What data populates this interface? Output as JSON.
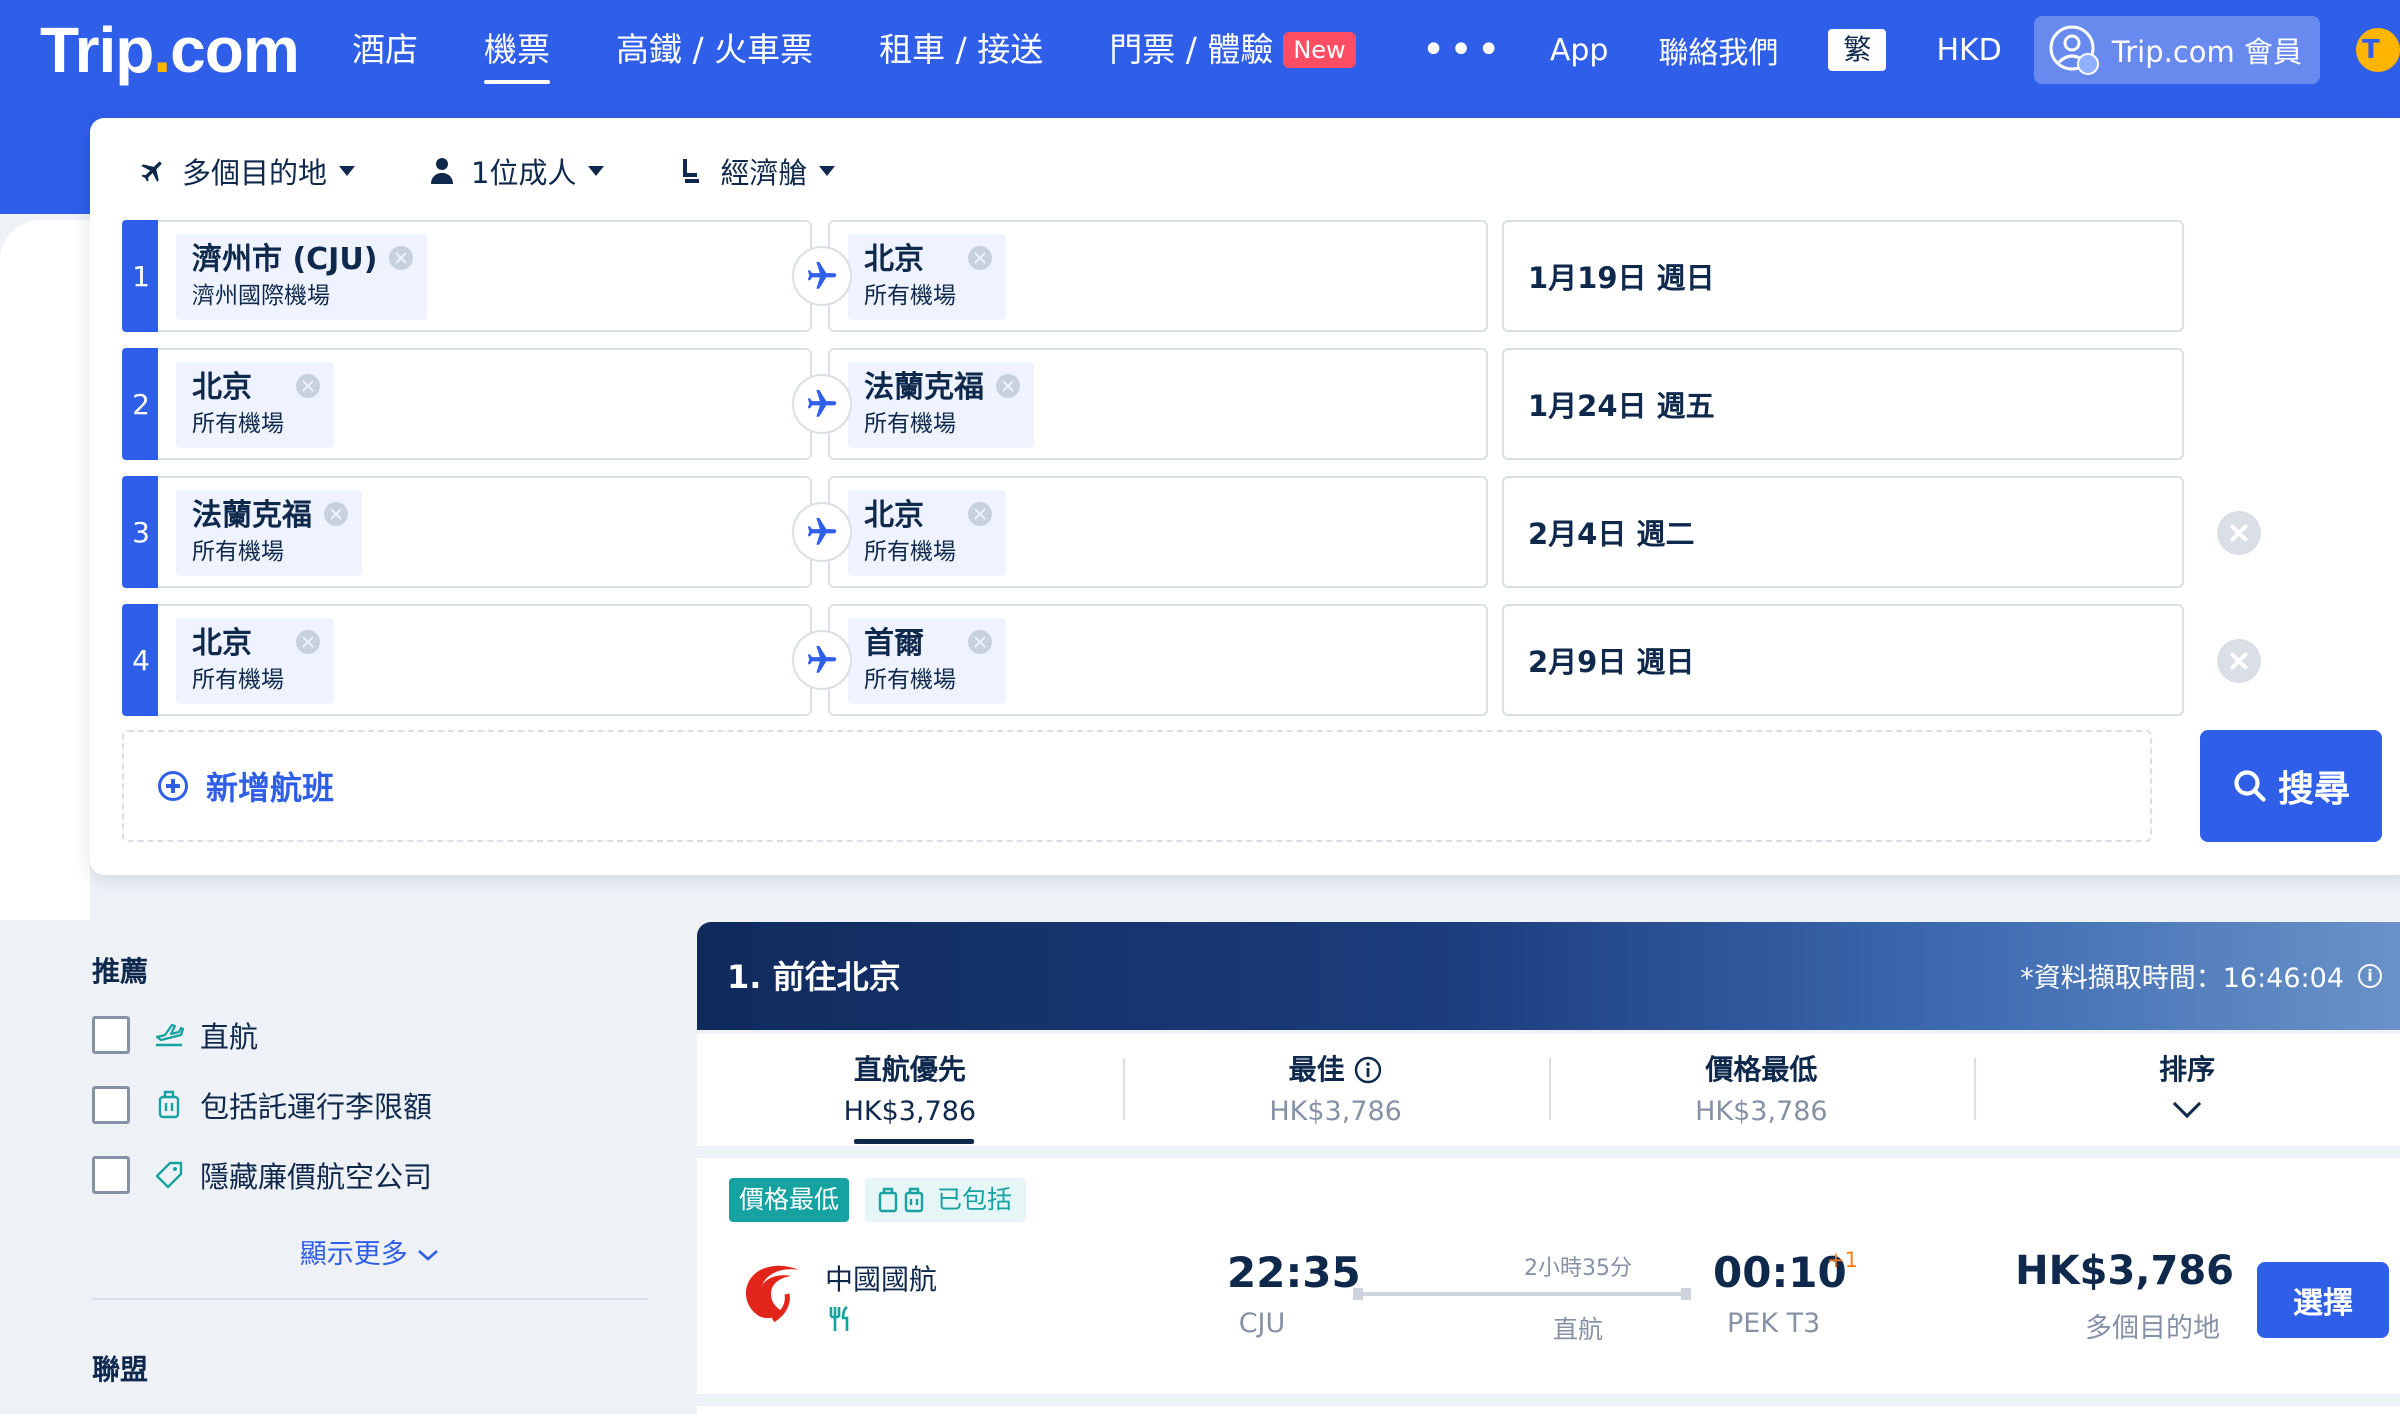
{
  "header": {
    "logo_part1": "Trip",
    "logo_dot": ".",
    "logo_part2": "com",
    "nav": [
      {
        "label": "酒店"
      },
      {
        "label": "機票"
      },
      {
        "label": "高鐵 / 火車票"
      },
      {
        "label": "租車 / 接送"
      },
      {
        "label": "門票 / 體驗"
      }
    ],
    "new_badge": "New",
    "more": "•••",
    "app": "App",
    "contact": "聯絡我們",
    "lang": "繁",
    "currency": "HKD",
    "member": "Trip.com 會員",
    "coin_letter": "T",
    "avatar_letter": "T"
  },
  "search": {
    "trip_type": "多個目的地",
    "passengers": "1位成人",
    "cabin": "經濟艙",
    "legs": [
      {
        "num": "1",
        "from_city": "濟州市 (CJU)",
        "from_sub": "濟州國際機場",
        "to_city": "北京",
        "to_sub": "所有機場",
        "date": "1月19日 週日"
      },
      {
        "num": "2",
        "from_city": "北京",
        "from_sub": "所有機場",
        "to_city": "法蘭克福",
        "to_sub": "所有機場",
        "date": "1月24日 週五"
      },
      {
        "num": "3",
        "from_city": "法蘭克福",
        "from_sub": "所有機場",
        "to_city": "北京",
        "to_sub": "所有機場",
        "date": "2月4日 週二"
      },
      {
        "num": "4",
        "from_city": "北京",
        "from_sub": "所有機場",
        "to_city": "首爾",
        "to_sub": "所有機場",
        "date": "2月9日 週日"
      }
    ],
    "add_flight": "新增航班",
    "search_button": "搜尋"
  },
  "filters": {
    "title": "推薦",
    "items": [
      {
        "label": "直航",
        "icon": "direct-flight-icon"
      },
      {
        "label": "包括託運行李限額",
        "icon": "luggage-icon"
      },
      {
        "label": "隱藏廉價航空公司",
        "icon": "tag-icon"
      }
    ],
    "show_more": "顯示更多",
    "alliance_title": "聯盟"
  },
  "results": {
    "title": "1. 前往北京",
    "fetch_time": "*資料擷取時間：16:46:04",
    "sort_tabs": [
      {
        "label": "直航優先",
        "price": "HK$3,786"
      },
      {
        "label": "最佳",
        "price": "HK$3,786"
      },
      {
        "label": "價格最低",
        "price": "HK$3,786"
      },
      {
        "label": "排序",
        "price": ""
      }
    ],
    "info_symbol": "i",
    "flight": {
      "tag_cheapest": "價格最低",
      "tag_included": "已包括",
      "airline": "中國國航",
      "dep_time": "22:35",
      "dep_airport": "CJU",
      "duration": "2小時35分",
      "stops": "直航",
      "arr_time": "00:10",
      "arr_day_offset": "+1",
      "arr_airport": "PEK T3",
      "price": "HK$3,786",
      "price_note": "多個目的地",
      "select_button": "選擇"
    }
  },
  "colors": {
    "brand_blue": "#2f5ee9",
    "logo_dot": "#ffb400",
    "new_badge": "#ff4e63",
    "teal_tag": "#17a2a2",
    "day_offset": "#ff7d13",
    "text_dark": "#0f294d",
    "text_muted": "#8592a6"
  }
}
